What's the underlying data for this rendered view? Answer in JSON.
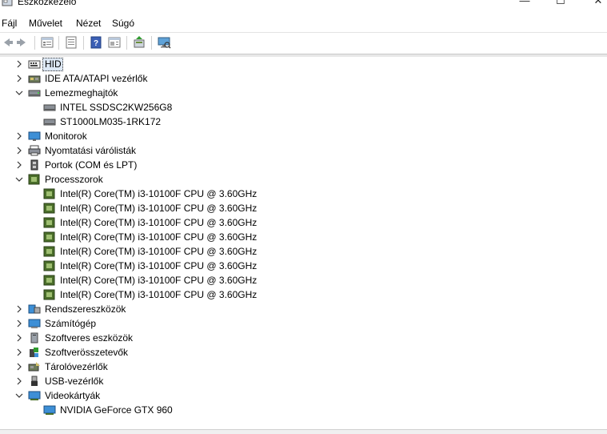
{
  "window": {
    "title": "Eszközkezelő",
    "minimize": "—",
    "maximize": "☐",
    "close": "✕"
  },
  "menu": [
    "Fájl",
    "Művelet",
    "Nézet",
    "Súgó"
  ],
  "toolbar": {
    "buttons": [
      "back-icon",
      "forward-icon",
      "properties-icon",
      "details-icon",
      "help-icon",
      "view-icon",
      "update-driver-icon",
      "scan-hardware-icon"
    ]
  },
  "tree": [
    {
      "label": "HID",
      "icon": "hid-icon",
      "expanded": false,
      "selected": true
    },
    {
      "label": "IDE ATA/ATAPI vezérlők",
      "icon": "ide-controller-icon",
      "expanded": false
    },
    {
      "label": "Lemezmeghajtók",
      "icon": "disk-drive-icon",
      "expanded": true,
      "children": [
        "INTEL SSDSC2KW256G8",
        "ST1000LM035-1RK172"
      ]
    },
    {
      "label": "Monitorok",
      "icon": "monitor-icon",
      "expanded": false
    },
    {
      "label": "Nyomtatási várólisták",
      "icon": "printer-icon",
      "expanded": false
    },
    {
      "label": "Portok (COM és LPT)",
      "icon": "port-icon",
      "expanded": false
    },
    {
      "label": "Processzorok",
      "icon": "processor-icon",
      "expanded": true,
      "children": [
        "Intel(R) Core(TM) i3-10100F CPU @ 3.60GHz",
        "Intel(R) Core(TM) i3-10100F CPU @ 3.60GHz",
        "Intel(R) Core(TM) i3-10100F CPU @ 3.60GHz",
        "Intel(R) Core(TM) i3-10100F CPU @ 3.60GHz",
        "Intel(R) Core(TM) i3-10100F CPU @ 3.60GHz",
        "Intel(R) Core(TM) i3-10100F CPU @ 3.60GHz",
        "Intel(R) Core(TM) i3-10100F CPU @ 3.60GHz",
        "Intel(R) Core(TM) i3-10100F CPU @ 3.60GHz"
      ]
    },
    {
      "label": "Rendszereszközök",
      "icon": "system-device-icon",
      "expanded": false
    },
    {
      "label": "Számítógép",
      "icon": "computer-icon",
      "expanded": false
    },
    {
      "label": "Szoftveres eszközök",
      "icon": "software-device-icon",
      "expanded": false
    },
    {
      "label": "Szoftverösszetevők",
      "icon": "software-component-icon",
      "expanded": false
    },
    {
      "label": "Tárolóvezérlők",
      "icon": "storage-controller-icon",
      "expanded": false
    },
    {
      "label": "USB-vezérlők",
      "icon": "usb-icon",
      "expanded": false
    },
    {
      "label": "Videokártyák",
      "icon": "display-adapter-icon",
      "expanded": true,
      "children": [
        "NVIDIA GeForce GTX 960"
      ]
    }
  ]
}
